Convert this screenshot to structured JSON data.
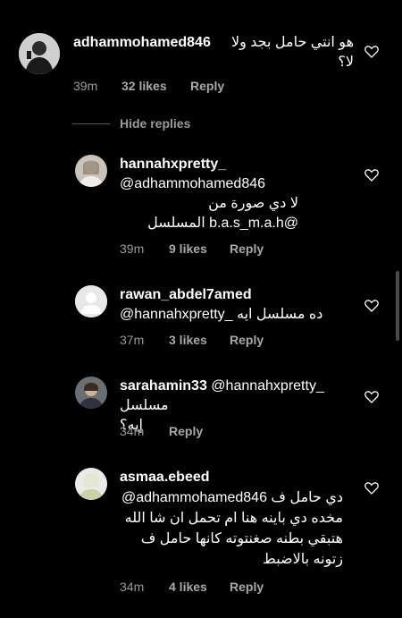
{
  "comments": [
    {
      "username": "adhammohamed846",
      "text": "هو انتي حامل بجد ولا لا؟",
      "time": "39m",
      "likes": "32 likes",
      "reply": "Reply"
    },
    {
      "username": "hannahxpretty_",
      "mention": "@adhammohamed846",
      "text": "لا دي صورة من @b.a.s_m.a.h المسلسل",
      "time": "39m",
      "likes": "9 likes",
      "reply": "Reply"
    },
    {
      "username": "rawan_abdel7amed",
      "text": "@hannahxpretty_ ده مسلسل ايه",
      "time": "37m",
      "likes": "3 likes",
      "reply": "Reply"
    },
    {
      "username": "sarahamin33",
      "mention": "@hannahxpretty_",
      "text": "مسلسل إيه؟",
      "time": "34m",
      "reply": "Reply"
    },
    {
      "username": "asmaa.ebeed",
      "text": "@adhammohamed846 دي حامل ف مخده دي باينه هنا ام تحمل ان شا الله هتبقي بطنه صغنتوته كانها حامل ف زتونه بالاضبط",
      "time": "34m",
      "likes": "4 likes",
      "reply": "Reply"
    }
  ],
  "hide_replies": "Hide replies",
  "colors": {
    "background": "#000000",
    "text": "#ffffff",
    "meta": "#9a9a9a"
  }
}
